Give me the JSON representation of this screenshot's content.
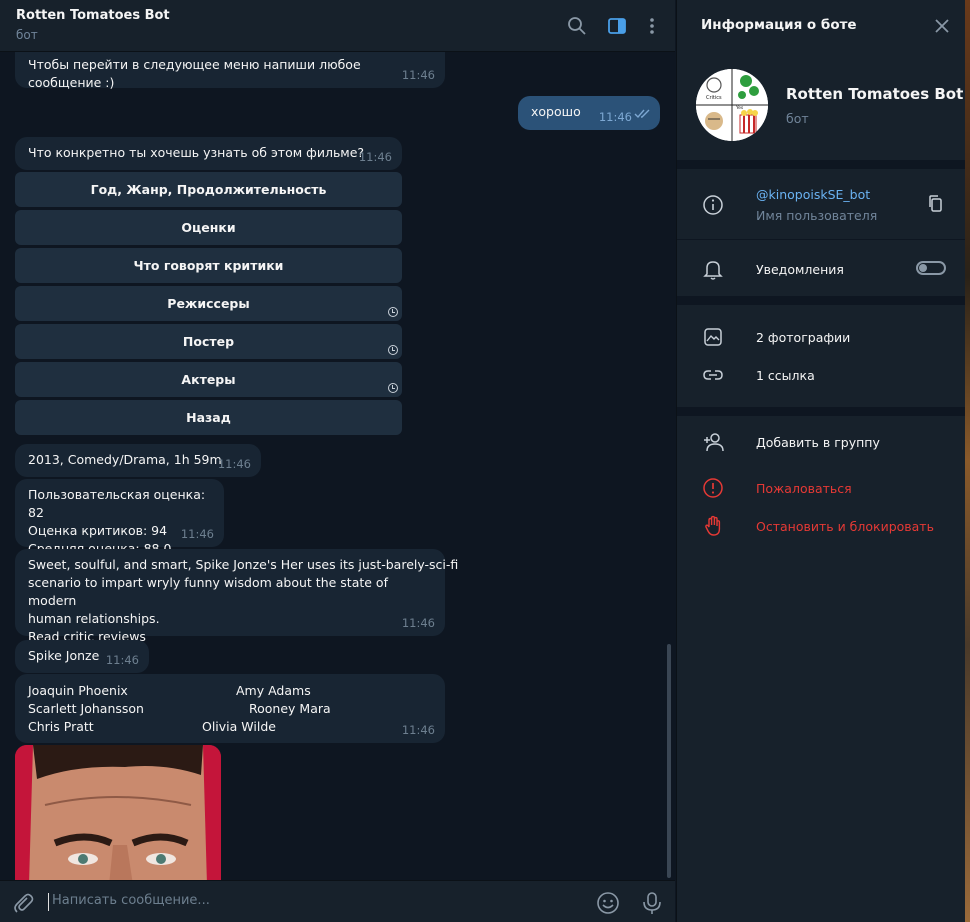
{
  "header": {
    "title": "Rotten Tomatoes Bot",
    "subtitle": "бот"
  },
  "messages": {
    "m1": {
      "text": "Чтобы перейти в следующее меню напиши любое сообщение :)",
      "time": "11:46"
    },
    "m2": {
      "text": "хорошо",
      "time": "11:46"
    },
    "m3": {
      "text": "Что конкретно ты хочешь узнать об этом фильме?",
      "time": "11:46"
    },
    "keyboard": [
      {
        "label": "Год, Жанр, Продолжительность"
      },
      {
        "label": "Оценки"
      },
      {
        "label": "Что говорят критики"
      },
      {
        "label": "Режиссеры"
      },
      {
        "label": "Постер"
      },
      {
        "label": "Актеры"
      },
      {
        "label": "Назад"
      }
    ],
    "m4": {
      "text": "2013, Comedy/Drama, 1h 59m",
      "time": "11:46"
    },
    "m5": {
      "line1": "Пользовательская оценка: 82",
      "line2": "Оценка критиков: 94",
      "line3": "Средняя оценка: 88.0",
      "time": "11:46"
    },
    "m6": {
      "line1": "Sweet, soulful, and smart, Spike Jonze's Her uses its just-barely-sci-fi",
      "line2": "scenario to impart wryly funny wisdom about the state of modern",
      "line3": "human relationships.",
      "line4": "Read critic reviews",
      "time": "11:46"
    },
    "m7": {
      "text": "Spike Jonze",
      "time": "11:46"
    },
    "m8": {
      "actors": [
        "Joaquin Phoenix",
        "Amy Adams",
        "Scarlett Johansson",
        "Rooney Mara",
        "Chris Pratt",
        "Olivia Wilde"
      ],
      "time": "11:46"
    }
  },
  "input": {
    "placeholder": "Написать сообщение..."
  },
  "panel": {
    "title": "Информация о боте",
    "name": "Rotten Tomatoes Bot",
    "type": "бот",
    "username": "@kinopoiskSE_bot",
    "username_label": "Имя пользователя",
    "notifications": "Уведомления",
    "notifications_on": false,
    "photos": "2 фотографии",
    "links": "1 ссылка",
    "add_to_group": "Добавить в группу",
    "report": "Пожаловаться",
    "block": "Остановить и блокировать",
    "avatar_texts": [
      "Critics",
      "Yes"
    ]
  },
  "colors": {
    "background": "#0e1621",
    "panel": "#17212b",
    "bubble_in": "#182533",
    "bubble_out": "#2b5278",
    "accent": "#6ab2f2",
    "danger": "#e53935"
  }
}
